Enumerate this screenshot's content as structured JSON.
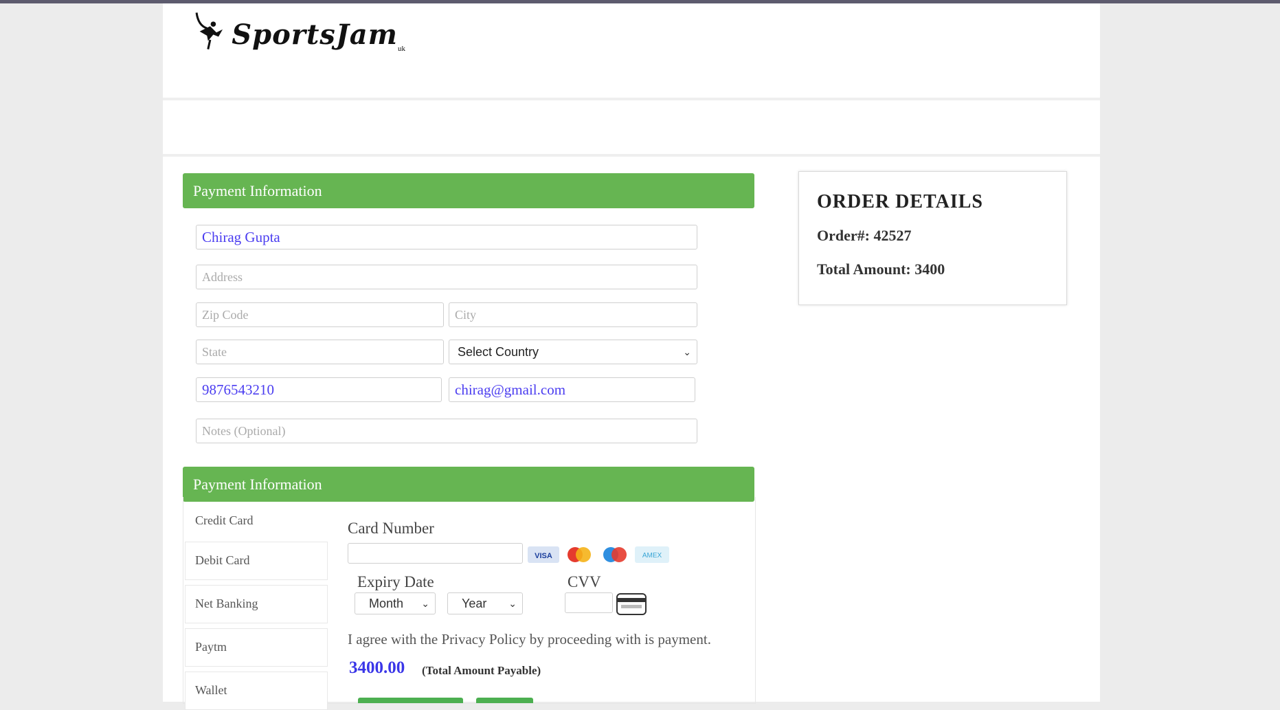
{
  "brand": {
    "logo_text": "SportsJam",
    "logo_sub": "uk"
  },
  "billing": {
    "header": "Payment Information",
    "name_value": "Chirag Gupta",
    "address_placeholder": "Address",
    "zip_placeholder": "Zip Code",
    "city_placeholder": "City",
    "state_placeholder": "State",
    "country_select": "Select Country",
    "phone_value": "9876543210",
    "email_value": "chirag@gmail.com",
    "notes_placeholder": "Notes (Optional)"
  },
  "payment": {
    "header": "Payment Information",
    "tabs": [
      "Credit Card",
      "Debit Card",
      "Net Banking",
      "Paytm",
      "Wallet"
    ],
    "card_number_label": "Card Number",
    "card_brands": [
      "visa-icon",
      "mastercard-icon",
      "maestro-icon",
      "amex-icon"
    ],
    "expiry_label": "Expiry Date",
    "month_select": "Month",
    "year_select": "Year",
    "cvv_label": "CVV",
    "agree_text": "I agree with the Privacy Policy by proceeding with is payment.",
    "amount": "3400.00",
    "amount_note": "(Total Amount Payable)"
  },
  "order": {
    "title": "ORDER DETAILS",
    "order_number": "Order#: 42527",
    "total": "Total Amount: 3400"
  },
  "colors": {
    "accent_green": "#66b552",
    "link_blue": "#4a3cf0"
  }
}
